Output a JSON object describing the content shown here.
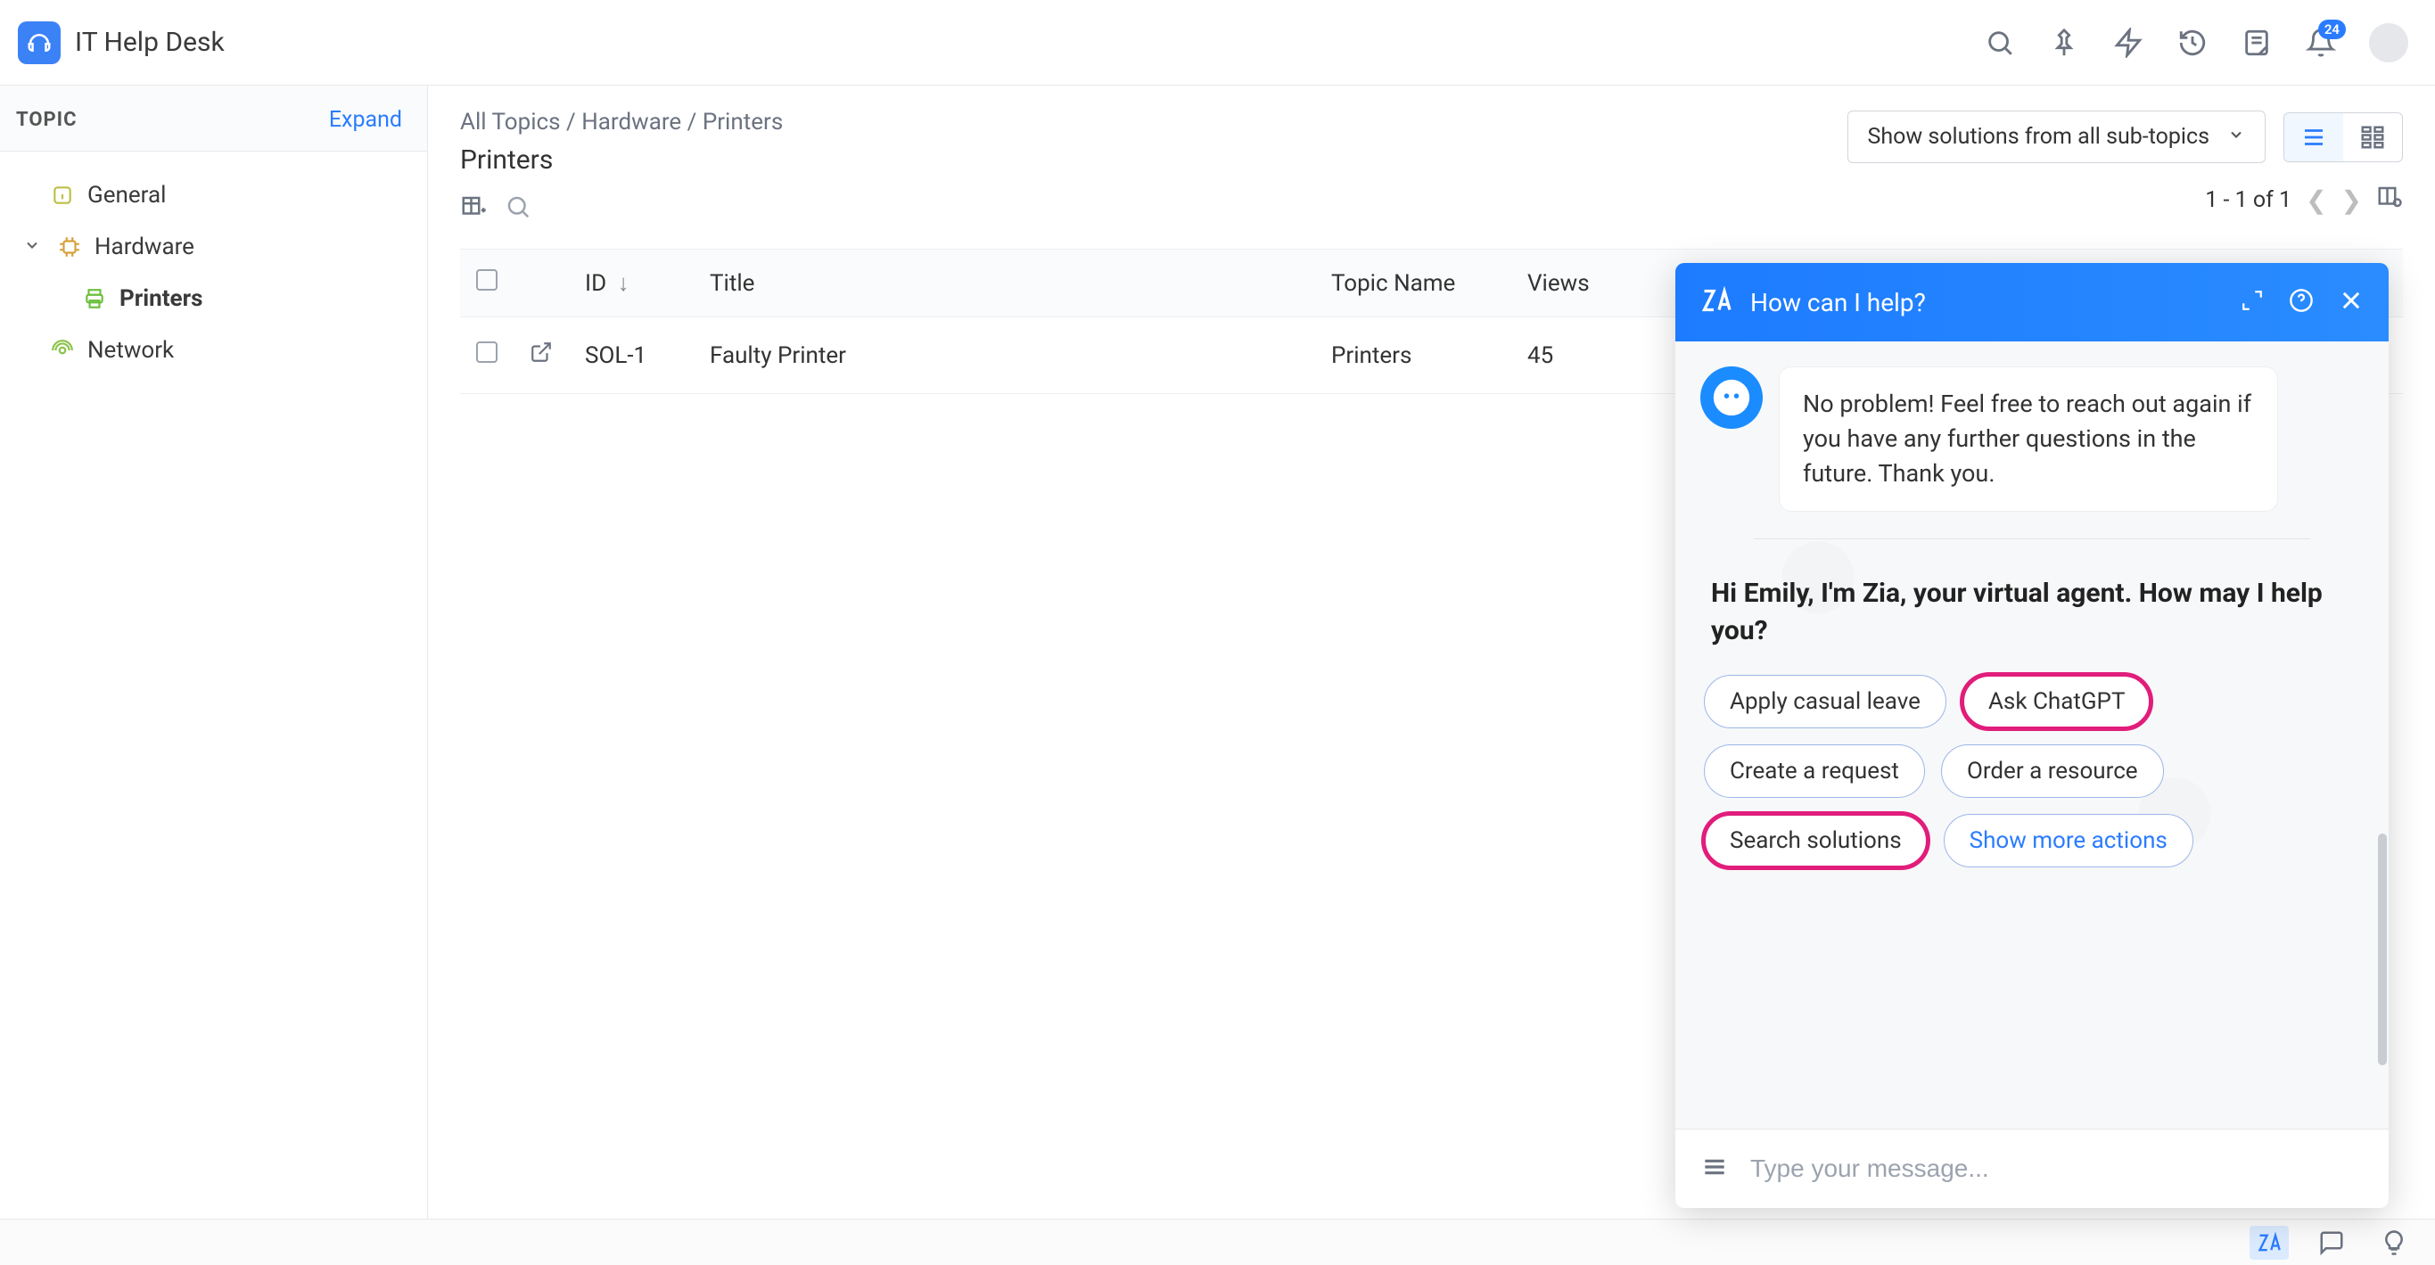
{
  "app": {
    "title": "IT Help Desk"
  },
  "notifications": {
    "count": "24"
  },
  "sidebar": {
    "heading": "TOPIC",
    "expand": "Expand",
    "items": [
      {
        "label": "General"
      },
      {
        "label": "Hardware"
      },
      {
        "label": "Printers"
      },
      {
        "label": "Network"
      }
    ]
  },
  "breadcrumb": {
    "a": "All Topics",
    "b": "Hardware",
    "c": "Printers",
    "sep": " / "
  },
  "page": {
    "title": "Printers"
  },
  "filter": {
    "label": "Show solutions from all sub-topics"
  },
  "pager": {
    "text": "1 - 1 of 1"
  },
  "table": {
    "headers": {
      "id": "ID",
      "title": "Title",
      "topic": "Topic Name",
      "views": "Views"
    },
    "rows": [
      {
        "id": "SOL-1",
        "title": "Faulty Printer",
        "topic": "Printers",
        "views": "45"
      }
    ]
  },
  "chat": {
    "header": "How can I help?",
    "bot_message": "No problem! Feel free to reach out again if you have any further questions in the future. Thank you.",
    "greeting": "Hi Emily, I'm Zia, your virtual agent. How may I help you?",
    "chips": {
      "apply_leave": "Apply casual leave",
      "ask_chatgpt": "Ask ChatGPT",
      "create_request": "Create a request",
      "order_resource": "Order a resource",
      "search_solutions": "Search solutions",
      "show_more": "Show more actions"
    },
    "input_placeholder": "Type your message..."
  }
}
